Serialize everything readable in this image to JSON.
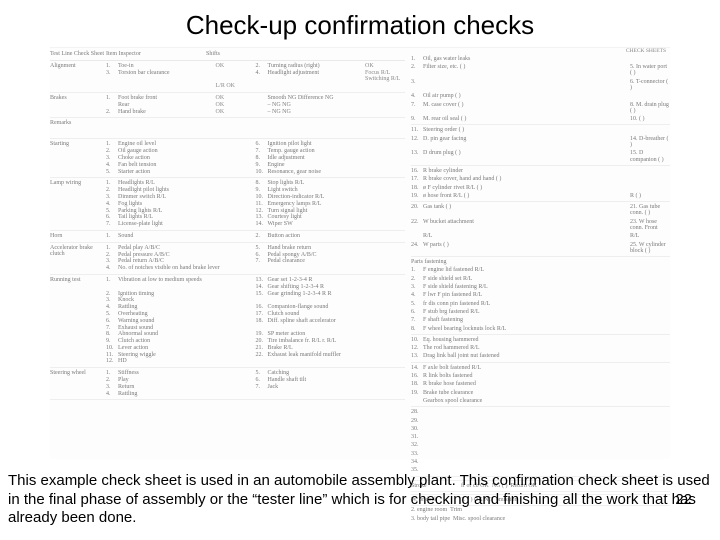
{
  "title": "Check-up confirmation checks",
  "page_number": "22",
  "caption": "This example check sheet is used in an automobile assembly plant.  This confirmation check sheet is used in the final phase of assembly or the “tester line” which is for checking and finishing all the work that has already been done.",
  "header": {
    "a": "Test Line Check Sheet",
    "b": "Item Inspector",
    "c": "Shifts"
  },
  "left_sections": [
    {
      "label": "Alignment",
      "items": [
        {
          "n": "1.",
          "t": "Toe-in",
          "e": "OK"
        },
        {
          "n": "2.",
          "t": "Turning radius (right)",
          "e": "OK"
        },
        {
          "n": "3.",
          "t": "Torsion bar clearance",
          "e": ""
        },
        {
          "n": "4.",
          "t": "Headlight adjustment",
          "e": "Focus R/L   Switching R/L"
        },
        {
          "n": "",
          "t": "",
          "e": "L/R  OK"
        }
      ]
    },
    {
      "label": "Brakes",
      "items": [
        {
          "n": "1.",
          "t": "Foot brake front",
          "e": "OK"
        },
        {
          "n": "",
          "t": "Smooth  NG  Difference  NG"
        },
        {
          "n": "",
          "t": "Rear",
          "e": "OK"
        },
        {
          "n": "",
          "t": "–  NG  NG"
        },
        {
          "n": "2.",
          "t": "Hand brake",
          "e": "OK"
        },
        {
          "n": "",
          "t": "–  NG  NG"
        }
      ]
    },
    {
      "label": "Remarks",
      "remarks": true
    },
    {
      "label": "Starting",
      "items": [
        {
          "n": "1.",
          "t": "Engine oil level"
        },
        {
          "n": "6.",
          "t": "Ignition pilot light"
        },
        {
          "n": "2.",
          "t": "Oil gauge action"
        },
        {
          "n": "7.",
          "t": "Temp. gauge action"
        },
        {
          "n": "3.",
          "t": "Choke action"
        },
        {
          "n": "8.",
          "t": "Idle adjustment"
        },
        {
          "n": "4.",
          "t": "Fan belt tension"
        },
        {
          "n": "9.",
          "t": "Engine"
        },
        {
          "n": "5.",
          "t": "Starter action"
        },
        {
          "n": "10.",
          "t": "Resonance, gear noise"
        }
      ]
    },
    {
      "label": "Lamp wiring",
      "items": [
        {
          "n": "1.",
          "t": "Headlights R/L"
        },
        {
          "n": "8.",
          "t": "Stop lights R/L"
        },
        {
          "n": "2.",
          "t": "Headlight pilot lights"
        },
        {
          "n": "9.",
          "t": "Light switch"
        },
        {
          "n": "3.",
          "t": "Dimmer switch R/L"
        },
        {
          "n": "10.",
          "t": "Direction-indicator R/L"
        },
        {
          "n": "4.",
          "t": "Fog lights"
        },
        {
          "n": "11.",
          "t": "Emergency lamps R/L"
        },
        {
          "n": "5.",
          "t": "Parking lights R/L"
        },
        {
          "n": "12.",
          "t": "Turn signal light"
        },
        {
          "n": "6.",
          "t": "Tail lights R/L"
        },
        {
          "n": "13.",
          "t": "Courtesy light"
        },
        {
          "n": "7.",
          "t": "License-plate light"
        },
        {
          "n": "14.",
          "t": "Wiper SW"
        }
      ]
    },
    {
      "label": "Horn",
      "items": [
        {
          "n": "1.",
          "t": "Sound"
        },
        {
          "n": "2.",
          "t": "Button action"
        }
      ]
    },
    {
      "label": "Accelerator brake clutch",
      "items": [
        {
          "n": "1.",
          "t": "Pedal play A/B/C"
        },
        {
          "n": "5.",
          "t": "Hand brake return"
        },
        {
          "n": "2.",
          "t": "Pedal pressure A/B/C"
        },
        {
          "n": "6.",
          "t": "Pedal spongy A/B/C"
        },
        {
          "n": "3.",
          "t": "Pedal return A/B/C"
        },
        {
          "n": "7.",
          "t": "Pedal clearance"
        },
        {
          "n": "4.",
          "t": "No. of notches visible on hand brake lever",
          "full": true
        }
      ]
    },
    {
      "label": "Running test",
      "items": [
        {
          "n": "1.",
          "t": "Vibration at low to medium speeds"
        },
        {
          "n": "13.",
          "t": "Gear set 1-2-3-4 R"
        },
        {
          "n": "",
          "t": ""
        },
        {
          "n": "14.",
          "t": "Gear shifting 1-2-3-4 R"
        },
        {
          "n": "2.",
          "t": "Ignition timing"
        },
        {
          "n": "15.",
          "t": "Gear grinding 1-2-3-4 R R"
        },
        {
          "n": "3.",
          "t": "Knock"
        },
        {
          "n": "",
          "t": ""
        },
        {
          "n": "4.",
          "t": "Rattling"
        },
        {
          "n": "16.",
          "t": "Companion-flange sound"
        },
        {
          "n": "5.",
          "t": "Overheating"
        },
        {
          "n": "17.",
          "t": "Clutch sound"
        },
        {
          "n": "6.",
          "t": "Warning sound"
        },
        {
          "n": "18.",
          "t": "Diff. spline shaft accelerator"
        },
        {
          "n": "7.",
          "t": "Exhaust sound"
        },
        {
          "n": "",
          "t": ""
        },
        {
          "n": "8.",
          "t": "Abnormal sound"
        },
        {
          "n": "19.",
          "t": "SP meter action"
        },
        {
          "n": "9.",
          "t": "Clutch action"
        },
        {
          "n": "20.",
          "t": "Tire imbalance fr. R/L r. R/L"
        },
        {
          "n": "10.",
          "t": "Lever action"
        },
        {
          "n": "21.",
          "t": "Brake R/L"
        },
        {
          "n": "11.",
          "t": "Steering wiggle"
        },
        {
          "n": "22.",
          "t": "Exhaust leak manifold muffler"
        },
        {
          "n": "12.",
          "t": "HD"
        },
        {
          "n": "",
          "t": ""
        }
      ]
    },
    {
      "label": "Steering wheel",
      "items": [
        {
          "n": "1.",
          "t": "Stiffness"
        },
        {
          "n": "5.",
          "t": "Catching"
        },
        {
          "n": "2.",
          "t": "Play"
        },
        {
          "n": "6.",
          "t": "Handle shaft tilt"
        },
        {
          "n": "3.",
          "t": "Return"
        },
        {
          "n": "7.",
          "t": "Jack"
        },
        {
          "n": "4.",
          "t": "Rattling"
        },
        {
          "n": "",
          "t": ""
        }
      ]
    }
  ],
  "right_top_label": "CHECK SHEETS",
  "right_sections": [
    {
      "label": "",
      "ritems": [
        {
          "n": "1.",
          "t": "Oil, gas water leaks",
          "c": ""
        },
        {
          "n": "2.",
          "t": "Filter size, etc. ( )",
          "c": "5. In water port ( )"
        },
        {
          "n": "3.",
          "t": "",
          "c": "6. T-connector ( )"
        },
        {
          "n": "4.",
          "t": "Oil air pump ( )",
          "c": ""
        },
        {
          "n": "7.",
          "t": "M. case cover ( )",
          "c": "8. M. drain plug ( )"
        },
        {
          "n": "9.",
          "t": "M. rear oil seal ( )",
          "c": "10. (       )"
        }
      ]
    },
    {
      "label": "",
      "ritems": [
        {
          "n": "11.",
          "t": "Steering order ( )",
          "c": ""
        },
        {
          "n": "12.",
          "t": "D. pin gear facing",
          "c": "14. D-breather ( )"
        },
        {
          "n": "13.",
          "t": "D drum plug ( )",
          "c": "15. D companion ( )"
        }
      ]
    },
    {
      "label": "",
      "ritems": [
        {
          "n": "16.",
          "t": "R brake cylinder",
          "c": ""
        },
        {
          "n": "17.",
          "t": "R brake cover, hand and hand ( )",
          "c": ""
        },
        {
          "n": "18.",
          "t": "ø F cylinder rivet R/L ( )",
          "c": ""
        },
        {
          "n": "19.",
          "t": "ø hose front R/L ( )",
          "c": "R ( )"
        }
      ]
    },
    {
      "label": "",
      "ritems": [
        {
          "n": "20.",
          "t": "Gas tank ( )",
          "c": "21. Gas tube conn. ( )"
        },
        {
          "n": "22.",
          "t": "W bucket attachment",
          "c": "23. W hose conn. Front"
        },
        {
          "n": "",
          "t": "R/L",
          "c": "R/L"
        },
        {
          "n": "24.",
          "t": "W parts ( )",
          "c": "25. W cylinder block ( )"
        }
      ]
    },
    {
      "label": "Parts fastening",
      "ritems": [
        {
          "n": "1.",
          "t": "F engine lid fastened R/L",
          "c": ""
        },
        {
          "n": "2.",
          "t": "F side shield set R/L",
          "c": ""
        },
        {
          "n": "3.",
          "t": "F side shield fastening R/L",
          "c": ""
        },
        {
          "n": "4.",
          "t": "F lwr F pin fastened R/L",
          "c": ""
        },
        {
          "n": "5.",
          "t": "fr dis conn pin fastened R/L",
          "c": ""
        },
        {
          "n": "6.",
          "t": "F stub brg fastened R/L",
          "c": ""
        },
        {
          "n": "7.",
          "t": "F shaft fastening",
          "c": ""
        },
        {
          "n": "8.",
          "t": "F wheel bearing locknuts lock R/L",
          "c": ""
        }
      ]
    },
    {
      "label": "",
      "ritems": [
        {
          "n": "10.",
          "t": "Eq. housing hammered",
          "c": ""
        },
        {
          "n": "12.",
          "t": "The rod hammered R/L",
          "c": ""
        },
        {
          "n": "13.",
          "t": "Drag link ball joint nut fastened",
          "c": ""
        }
      ]
    },
    {
      "label": "",
      "ritems": [
        {
          "n": "14.",
          "t": "F axle bolt fastened R/L",
          "c": ""
        },
        {
          "n": "16.",
          "t": "R link bolts fastened",
          "c": ""
        },
        {
          "n": "18.",
          "t": "R brake hose fastened",
          "c": ""
        },
        {
          "n": "19.",
          "t": "Brake tube clearance",
          "c": ""
        },
        {
          "n": "",
          "t": "Gearbox spool clearance",
          "c": ""
        }
      ]
    },
    {
      "label": "",
      "ritems": [
        {
          "n": "28.",
          "t": "",
          "c": ""
        },
        {
          "n": "29.",
          "t": "",
          "c": ""
        },
        {
          "n": "30.",
          "t": "",
          "c": ""
        },
        {
          "n": "31.",
          "t": "",
          "c": ""
        },
        {
          "n": "32.",
          "t": "",
          "c": ""
        },
        {
          "n": "33.",
          "t": "",
          "c": ""
        },
        {
          "n": "34.",
          "t": "",
          "c": ""
        },
        {
          "n": "35.",
          "t": "",
          "c": ""
        }
      ]
    }
  ],
  "sig": {
    "a": "Stroke",
    "b": "fr or cb   OK",
    "c": "NG ( )",
    "d": "Return OK"
  },
  "sig2": {
    "a": "W. or dock",
    "b": "1.  ( )   OK   NG",
    "c": "",
    "d": "omission"
  },
  "sig3": {
    "b": "2.  engine room",
    "c": "Trim"
  },
  "sig4": {
    "b": "3.  body tail pipe",
    "c": "Misc. spool clearance"
  }
}
